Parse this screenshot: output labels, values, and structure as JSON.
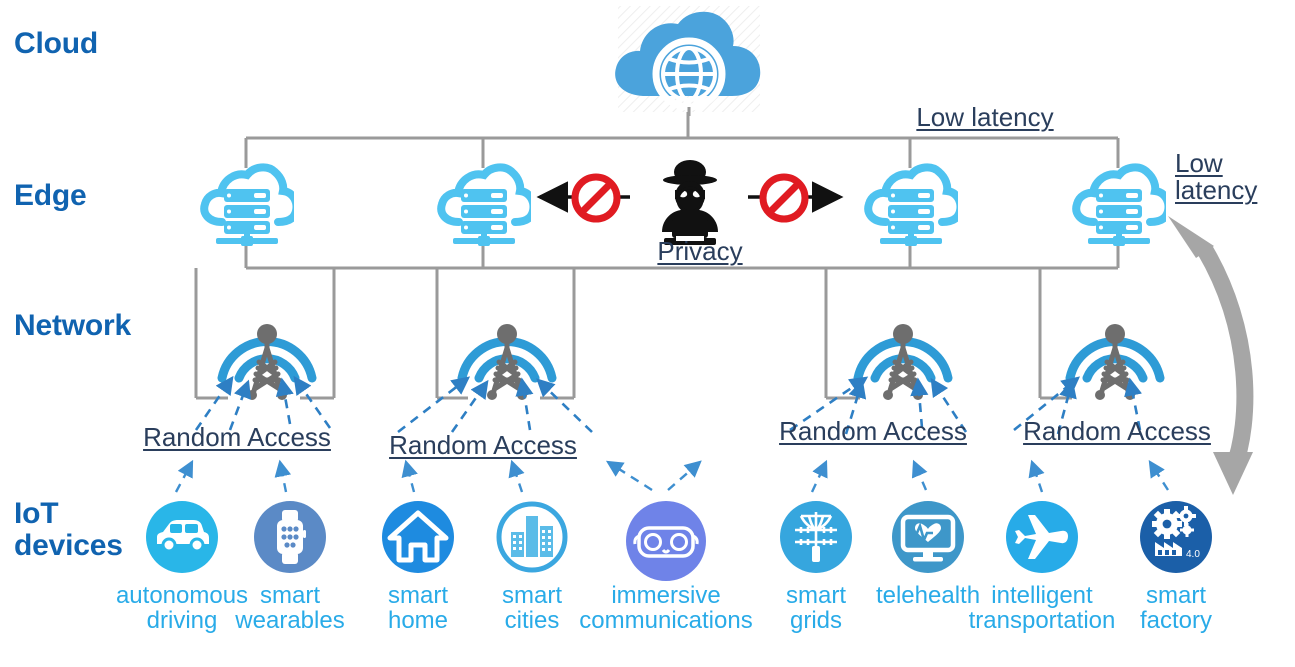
{
  "title": "IoT / Network / Edge / Cloud layered architecture",
  "colors": {
    "layer_label": "#1063B0",
    "annotation": "#2A3E5C",
    "device_label": "#29ABE8",
    "cloud_fill": "#4BA3DC",
    "edge_icon": "#4FC3F0",
    "tower_arc": "#2E9BD6",
    "tower_body": "#6E6E6E",
    "connector_gray": "#9A9A9A",
    "dashed_arrow": "#2E7FC4",
    "prohibit_red": "#E01B22",
    "hacker_black": "#111111",
    "big_arrow_gray": "#A6A6A6"
  },
  "layers": [
    {
      "id": "cloud",
      "label": "Cloud"
    },
    {
      "id": "edge",
      "label": "Edge"
    },
    {
      "id": "network",
      "label": "Network"
    },
    {
      "id": "iot",
      "label": "IoT\ndevices"
    }
  ],
  "cloud_node": {
    "icon": "cloud-globe-icon",
    "label": ""
  },
  "edge_nodes": [
    {
      "icon": "edge-server-cloud-icon"
    },
    {
      "icon": "edge-server-cloud-icon"
    },
    {
      "icon": "edge-server-cloud-icon"
    },
    {
      "icon": "edge-server-cloud-icon"
    }
  ],
  "network_nodes": [
    {
      "icon": "cell-tower-icon"
    },
    {
      "icon": "cell-tower-icon"
    },
    {
      "icon": "cell-tower-icon"
    },
    {
      "icon": "cell-tower-icon"
    }
  ],
  "attacker": {
    "icon": "hacker-icon",
    "label": "Privacy",
    "block_left_icon": "prohibition-icon",
    "block_right_icon": "prohibition-icon"
  },
  "annotations": [
    {
      "id": "low-latency-top",
      "text": "Low latency"
    },
    {
      "id": "low-latency-right",
      "text": "Low \nlatency"
    },
    {
      "id": "random-access-1",
      "text": "Random Access"
    },
    {
      "id": "random-access-2",
      "text": "Random Access"
    },
    {
      "id": "random-access-3",
      "text": "Random Access"
    },
    {
      "id": "random-access-4",
      "text": "Random Access"
    }
  ],
  "devices": [
    {
      "id": "autonomous-driving",
      "icon": "car-icon",
      "label": "autonomous\ndriving",
      "circle": "#29B6E8",
      "style": "solid"
    },
    {
      "id": "smart-wearables",
      "icon": "smartwatch-icon",
      "label": "smart\nwearables",
      "circle": "#5B8AC6",
      "style": "solid"
    },
    {
      "id": "smart-home",
      "icon": "house-icon",
      "label": "smart\nhome",
      "circle": "#1E8BE0",
      "style": "solid"
    },
    {
      "id": "smart-cities",
      "icon": "buildings-icon",
      "label": "smart\ncities",
      "circle": "#3BA7E0",
      "style": "outline"
    },
    {
      "id": "immersive-communications",
      "icon": "vr-goggles-icon",
      "label": "immersive\ncommunications",
      "circle": "#6F83E8",
      "style": "solid"
    },
    {
      "id": "smart-grids",
      "icon": "power-line-icon",
      "label": "smart\ngrids",
      "circle": "#36A6DE",
      "style": "solid"
    },
    {
      "id": "telehealth",
      "icon": "monitor-heart-icon",
      "label": "telehealth",
      "circle": "#3E97C9",
      "style": "solid"
    },
    {
      "id": "intelligent-transportation",
      "icon": "airplane-icon",
      "label": "intelligent\ntransportation",
      "circle": "#27ABE8",
      "style": "solid"
    },
    {
      "id": "smart-factory",
      "icon": "factory-gears-icon",
      "label": "smart\nfactory",
      "circle": "#1B5FA8",
      "style": "solid",
      "badge": "4.0"
    }
  ],
  "big_arrow": {
    "id": "low-latency-feedback-arrow",
    "icon": "double-curved-arrow-icon"
  }
}
